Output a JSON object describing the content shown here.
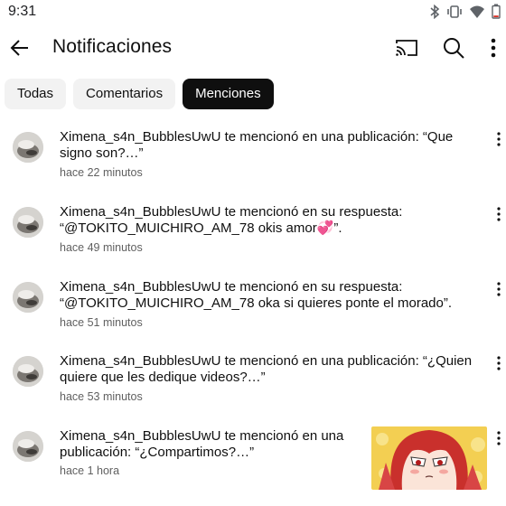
{
  "status_bar": {
    "time": "9:31"
  },
  "app_bar": {
    "title": "Notificaciones"
  },
  "tabs": [
    {
      "label": "Todas",
      "active": false
    },
    {
      "label": "Comentarios",
      "active": false
    },
    {
      "label": "Menciones",
      "active": true
    }
  ],
  "notifications": [
    {
      "line1": "Ximena_s4n_BubblesUwU te mencionó en una publicación: “Que",
      "line2": "signo son?…”",
      "time": "hace 22 minutos"
    },
    {
      "line1": "Ximena_s4n_BubblesUwU te mencionó en su respuesta:",
      "line2": "“@TOKITO_MUICHIRO_AM_78 okis amor💞”.",
      "time": "hace 49 minutos"
    },
    {
      "line1": "Ximena_s4n_BubblesUwU te mencionó en su respuesta:",
      "line2": "“@TOKITO_MUICHIRO_AM_78 oka si quieres ponte el morado”.",
      "time": "hace 51 minutos"
    },
    {
      "line1": "Ximena_s4n_BubblesUwU te mencionó en una publicación: “¿Quien",
      "line2": "quiere que les dedique videos?…”",
      "time": "hace 53 minutos"
    },
    {
      "line1": "Ximena_s4n_BubblesUwU te mencionó en una",
      "line2": "publicación: “¿Compartimos?…”",
      "time": "hace 1 hora",
      "has_thumbnail": true
    }
  ],
  "icons": {
    "back": "arrow-left-icon",
    "cast": "cast-icon",
    "search": "search-icon",
    "more": "more-vertical-icon",
    "bluetooth": "bluetooth-icon",
    "vibrate": "vibrate-icon",
    "wifi": "wifi-icon",
    "battery": "battery-icon"
  },
  "colors": {
    "active_chip_bg": "#0f0f0f",
    "chip_bg": "#f2f2f2",
    "secondary_text": "#606060"
  }
}
